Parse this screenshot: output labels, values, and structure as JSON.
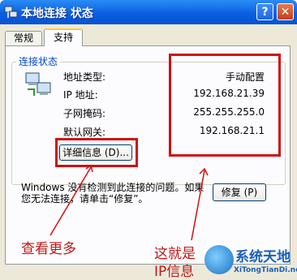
{
  "window": {
    "title": "本地连接 状态",
    "help_label": "?",
    "close_label": "✕"
  },
  "tabs": [
    {
      "label": "常规"
    },
    {
      "label": "支持"
    }
  ],
  "connection_status": {
    "group_title": "连接状态",
    "rows": [
      {
        "label": "地址类型:",
        "value": "手动配置"
      },
      {
        "label": "IP 地址:",
        "value": "192.168.21.39"
      },
      {
        "label": "子网掩码:",
        "value": "255.255.255.0"
      },
      {
        "label": "默认网关:",
        "value": "192.168.21.1"
      }
    ],
    "details_button": "详细信息 (D)..."
  },
  "message": "Windows 没有检测到此连接的问题。如果您无法连接，请单击“修复”。",
  "repair_button": "修复 (P)",
  "annotations": {
    "left_text": "查看更多",
    "right_text_line1": "这就是",
    "right_text_line2": "IP信息",
    "color": "#d01010"
  },
  "watermark": {
    "main": "系统天地",
    "sub": "XiTongTianDi.net"
  }
}
